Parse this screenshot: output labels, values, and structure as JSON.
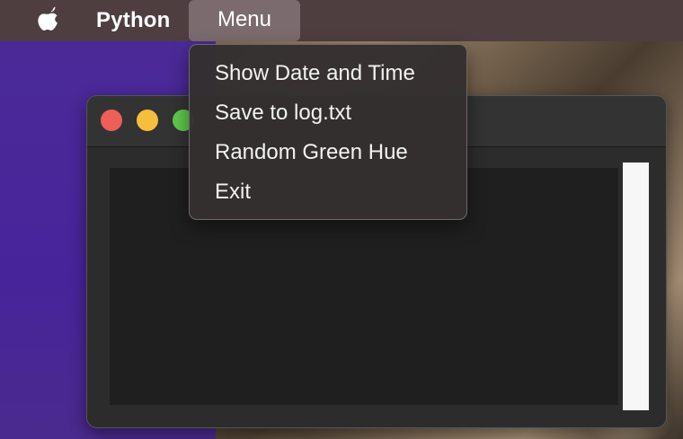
{
  "menubar": {
    "app_name": "Python",
    "menu_title": "Menu"
  },
  "dropdown": {
    "items": [
      {
        "label": "Show Date and Time"
      },
      {
        "label": "Save to log.txt"
      },
      {
        "label": "Random Green Hue"
      },
      {
        "label": "Exit"
      }
    ]
  },
  "icons": {
    "apple": "apple-icon",
    "close": "close-button",
    "minimize": "minimize-button",
    "maximize": "maximize-button"
  },
  "colors": {
    "menubar": "#4e3e40",
    "menu_highlight": "#7b6b6e",
    "close": "#ed5f58",
    "minimize": "#f6be3c",
    "maximize": "#5fc94c"
  }
}
